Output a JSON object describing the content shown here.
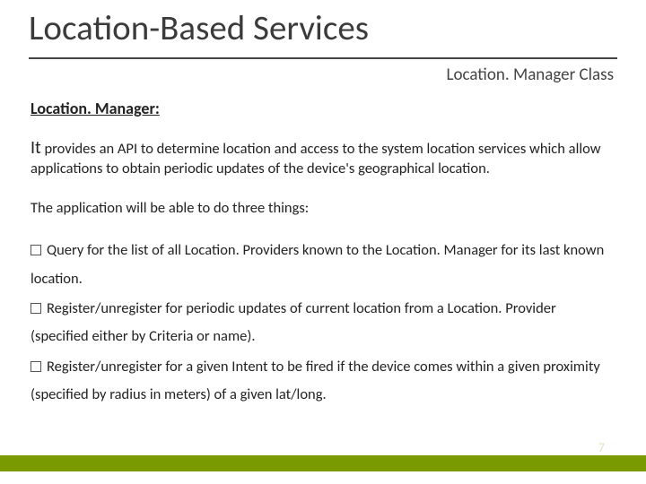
{
  "title": "Location-Based Services",
  "subtitle_right": "Location. Manager Class",
  "section_label": "Location. Manager:",
  "paragraph1_lead": "It",
  "paragraph1_rest": " provides an API to determine location and access to the system location services which allow applications to obtain periodic updates of the device's geographical location.",
  "paragraph2": "The application will be able to do three things:",
  "bullets": [
    "Query for the list of all Location. Providers known to the Location. Manager for its last known location.",
    "Register/unregister for periodic updates of current location from a Location. Provider  (specified either by Criteria or name).",
    "Register/unregister for a given Intent to be fired if the device comes within a given proximity (specified by radius in meters) of a given lat/long."
  ],
  "page_number": "7"
}
